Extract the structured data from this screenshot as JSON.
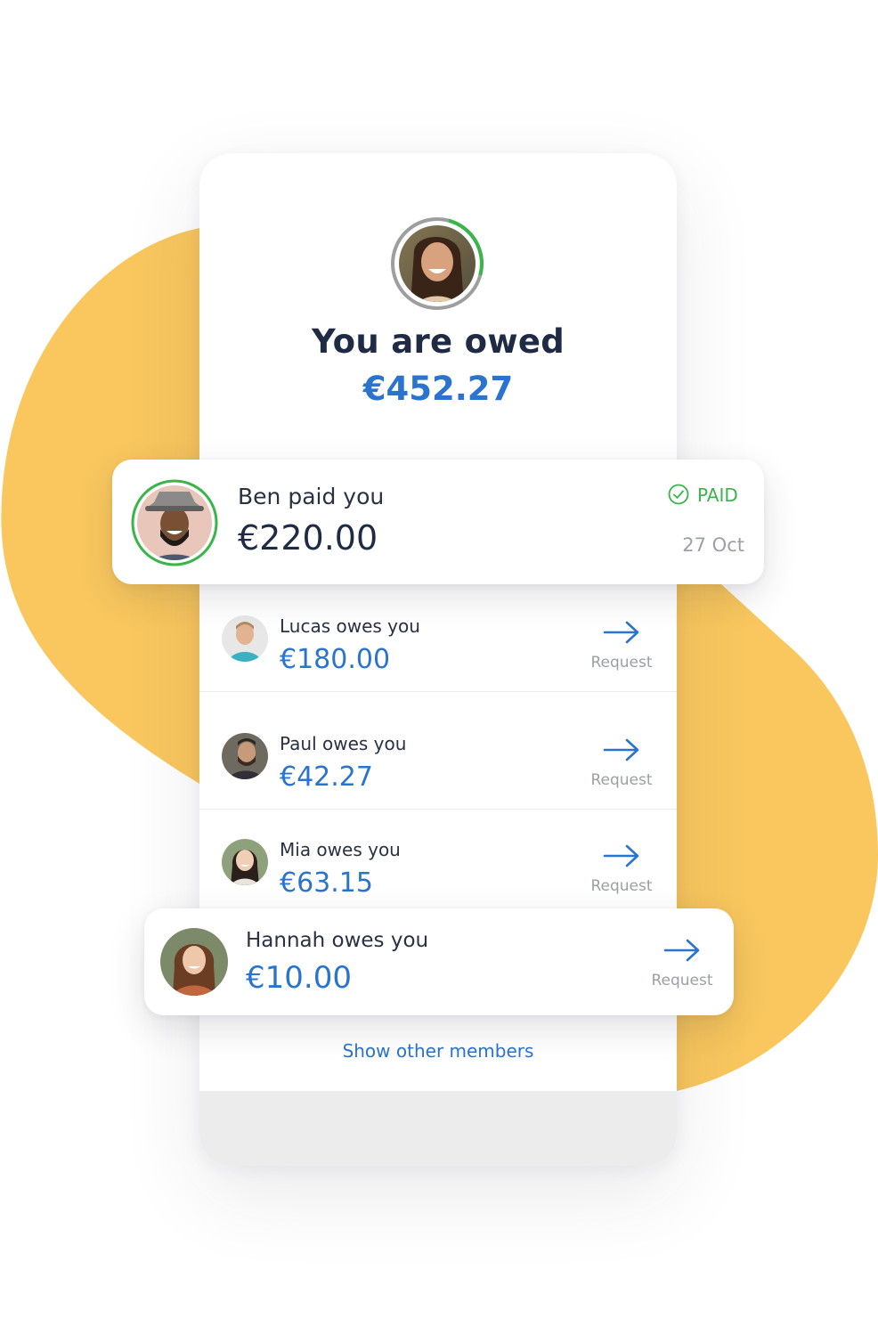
{
  "summary": {
    "title": "You are owed",
    "amount": "€452.27"
  },
  "highlight": {
    "name": "Ben paid you",
    "amount": "€220.00",
    "status": "PAID",
    "date": "27 Oct"
  },
  "members": [
    {
      "name": "Lucas owes you",
      "amount": "€180.00",
      "action": "Request"
    },
    {
      "name": "Paul owes you",
      "amount": "€42.27",
      "action": "Request"
    },
    {
      "name": "Mia owes you",
      "amount": "€63.15",
      "action": "Request"
    },
    {
      "name": "Hannah owes you",
      "amount": "€10.00",
      "action": "Request"
    }
  ],
  "show_more": "Show other members",
  "colors": {
    "accent": "#2a74d0",
    "paid": "#39b54a",
    "blob": "#f9c75e",
    "title": "#1f2a44"
  },
  "icons": {
    "paid": "check-circle-icon",
    "request": "arrow-right-icon"
  }
}
